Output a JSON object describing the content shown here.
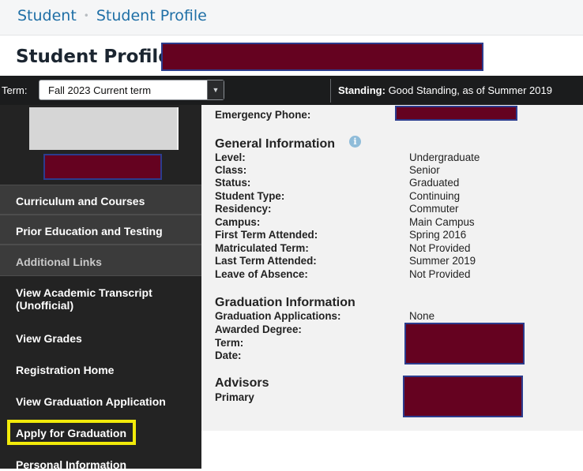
{
  "breadcrumb": {
    "root": "Student",
    "separator": "•",
    "current": "Student Profile"
  },
  "page": {
    "title": "Student Profile"
  },
  "termbar": {
    "term_label": "Term:",
    "term_value": "Fall 2023 Current term",
    "caret": "▼",
    "standing_label": "Standing:",
    "standing_value": "Good Standing, as of Summer 2019"
  },
  "sidebar": {
    "items": [
      {
        "label": "Curriculum and Courses"
      },
      {
        "label": "Prior Education and Testing"
      },
      {
        "label": "Additional Links"
      },
      {
        "label": "View Academic Transcript (Unofficial)"
      },
      {
        "label": "View Grades"
      },
      {
        "label": "Registration Home"
      },
      {
        "label": "View Graduation Application"
      },
      {
        "label": "Apply for Graduation"
      },
      {
        "label": "Personal Information"
      }
    ]
  },
  "main": {
    "emergency_phone_label": "Emergency Phone:",
    "general": {
      "heading": "General Information",
      "info_icon": "i",
      "fields": [
        {
          "label": "Level:",
          "value": "Undergraduate"
        },
        {
          "label": "Class:",
          "value": "Senior"
        },
        {
          "label": "Status:",
          "value": "Graduated"
        },
        {
          "label": "Student Type:",
          "value": "Continuing"
        },
        {
          "label": "Residency:",
          "value": "Commuter"
        },
        {
          "label": "Campus:",
          "value": "Main Campus"
        },
        {
          "label": "First Term Attended:",
          "value": "Spring 2016"
        },
        {
          "label": "Matriculated Term:",
          "value": "Not Provided"
        },
        {
          "label": "Last Term Attended:",
          "value": "Summer 2019"
        },
        {
          "label": "Leave of Absence:",
          "value": "Not Provided"
        }
      ]
    },
    "graduation": {
      "heading": "Graduation Information",
      "applications_label": "Graduation Applications:",
      "applications_value": "None",
      "awarded_degree_label": "Awarded Degree:",
      "term_label": "Term:",
      "date_label": "Date:"
    },
    "advisors": {
      "heading": "Advisors",
      "primary_label": "Primary"
    }
  },
  "colors": {
    "redaction": "#650220",
    "redaction_border": "#2c3c8e",
    "highlight": "#f2ea0a",
    "link": "#1f6fa6",
    "sidebar_bg": "#232323"
  }
}
